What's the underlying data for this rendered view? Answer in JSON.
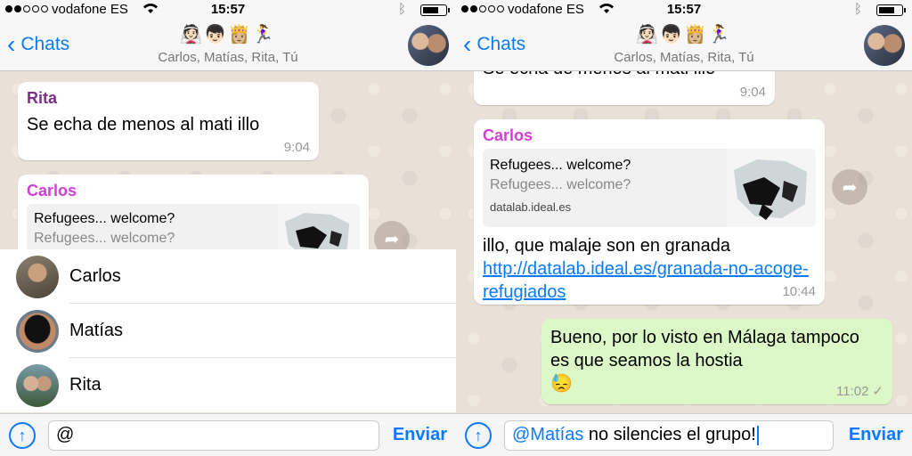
{
  "status": {
    "carrier": "vodafone ES",
    "time": "15:57"
  },
  "header": {
    "back_label": "Chats",
    "participants_emoji": "👰🏻👦🏻👸🏼🏃‍♀️",
    "subtitle": "Carlos, Matías, Rita, Tú"
  },
  "left": {
    "rita_message": {
      "sender": "Rita",
      "text": "Se echa de menos al mati illo",
      "time": "9:04"
    },
    "carlos_message": {
      "sender": "Carlos",
      "preview_title": "Refugees... welcome?",
      "preview_desc": "Refugees... welcome?"
    },
    "mention_list": [
      {
        "name": "Carlos"
      },
      {
        "name": "Matías"
      },
      {
        "name": "Rita"
      }
    ],
    "input_text": "@",
    "send_label": "Enviar"
  },
  "right": {
    "rita_tail": {
      "text": "Se echa de menos al mati illo",
      "time": "9:04"
    },
    "carlos_message": {
      "sender": "Carlos",
      "preview_title": "Refugees... welcome?",
      "preview_desc": "Refugees... welcome?",
      "preview_domain": "datalab.ideal.es",
      "text": "illo, que malaje son en granada",
      "link": "http://datalab.ideal.es/granada-no-acoge-refugiados",
      "time": "10:44"
    },
    "my_message": {
      "text": "Bueno, por lo visto en Málaga tampoco es que seamos la hostia",
      "emoji": "😓",
      "time": "11:02",
      "ticks": "✓"
    },
    "input_mention": "@Matías",
    "input_text": " no silencies el grupo!",
    "send_label": "Enviar"
  },
  "icons": {
    "back": "chevron-left-icon",
    "attach": "upload-arrow-icon",
    "forward": "forward-arrow-icon",
    "wifi": "wifi-icon",
    "bluetooth": "bluetooth-icon",
    "battery": "battery-icon"
  },
  "colors": {
    "ios_blue": "#0a7aff",
    "rita_name": "#7b2f8a",
    "carlos_name": "#d23ed8",
    "outgoing_bubble": "#dcf8c6"
  }
}
